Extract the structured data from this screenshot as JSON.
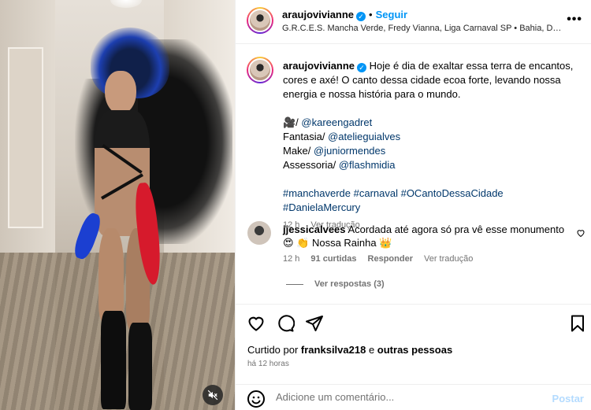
{
  "header": {
    "username": "araujovivianne",
    "follow_label": "Seguir",
    "location": "G.R.C.E.S. Mancha Verde, Fredy Vianna, Liga Carnaval SP • Bahia, Da fé...",
    "more_icon": "more-horizontal-icon"
  },
  "caption": {
    "username": "araujovivianne",
    "text_line1": "Hoje é dia de exaltar essa terra de encantos, cores e axé! O canto dessa cidade ecoa forte, levando nossa energia e nossa história para o mundo.",
    "credit_camera_prefix": "🎥/ ",
    "credit_camera_handle": "@kareengadret",
    "credit_fantasia_prefix": "Fantasia/ ",
    "credit_fantasia_handle": "@atelieguialves",
    "credit_make_prefix": "Make/ ",
    "credit_make_handle": "@juniormendes",
    "credit_assessoria_prefix": "Assessoria/ ",
    "credit_assessoria_handle": "@flashmidia",
    "hashtags": "#manchaverde #carnaval #OCantoDessaCidade #DanielaMercury",
    "time": "12 h",
    "translate": "Ver tradução"
  },
  "comment": {
    "username": "jjessicalvees",
    "text": "Acordada até agora só pra vê esse monumento",
    "text2": "😍 👏 Nossa Rainha 👑",
    "time": "12 h",
    "likes": "91 curtidas",
    "reply": "Responder",
    "translate": "Ver tradução",
    "view_replies": "Ver respostas (3)"
  },
  "footer": {
    "liked_by_prefix": "Curtido por ",
    "liked_by_user": "franksilva218",
    "liked_by_middle": " e ",
    "liked_by_others": "outras pessoas",
    "time_ago": "há 12 horas",
    "comment_placeholder": "Adicione um comentário...",
    "post_label": "Postar"
  },
  "colors": {
    "link": "#00376b",
    "accent": "#0095f6",
    "muted": "#737373"
  }
}
